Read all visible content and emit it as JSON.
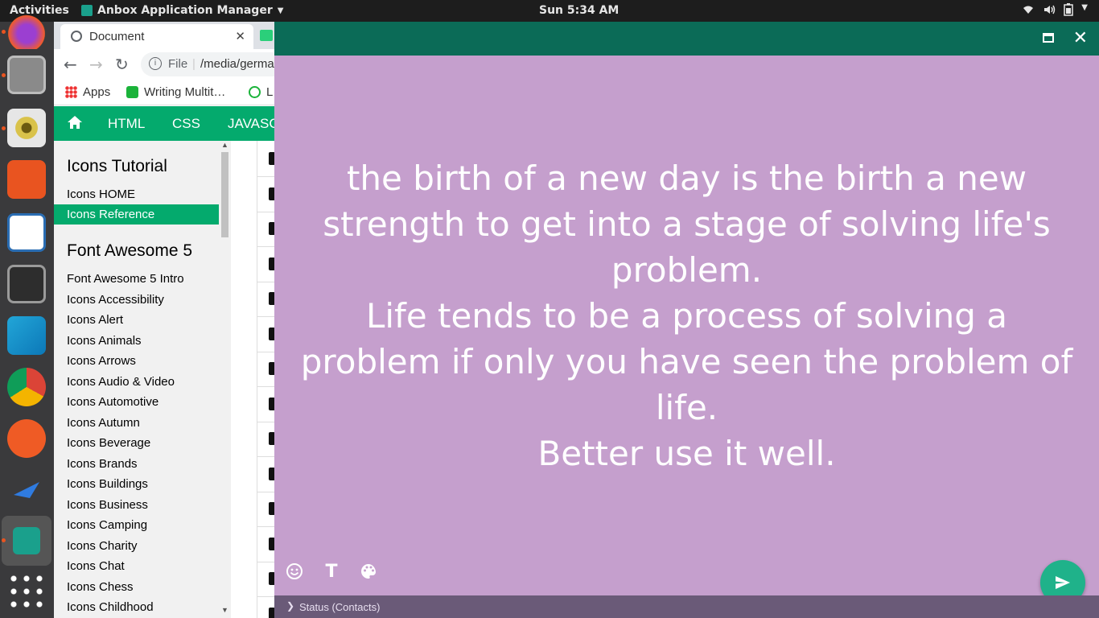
{
  "topbar": {
    "activities": "Activities",
    "app_menu": "Anbox Application Manager",
    "clock": "Sun  5:34 AM"
  },
  "dock": {
    "items": [
      "firefox-icon",
      "files-icon",
      "rhythmbox-icon",
      "software-center-icon",
      "writer-icon",
      "terminal-icon",
      "vscode-icon",
      "chrome-icon",
      "postman-icon",
      "kingfisher-icon",
      "anbox-icon",
      "app-grid-icon"
    ]
  },
  "browser": {
    "tab_title": "Document",
    "omnibox": {
      "scheme": "File",
      "url": "/media/german"
    },
    "bookmarks": [
      "Apps",
      "Writing Multit…",
      "L"
    ],
    "site_nav": [
      "HTML",
      "CSS",
      "JAVASC"
    ],
    "sidebar": {
      "heading1": "Icons Tutorial",
      "links1": [
        "Icons HOME",
        "Icons Reference"
      ],
      "heading2": "Font Awesome 5",
      "links2": [
        "Font Awesome 5 Intro",
        "Icons Accessibility",
        "Icons Alert",
        "Icons Animals",
        "Icons Arrows",
        "Icons Audio & Video",
        "Icons Automotive",
        "Icons Autumn",
        "Icons Beverage",
        "Icons Brands",
        "Icons Buildings",
        "Icons Business",
        "Icons Camping",
        "Icons Charity",
        "Icons Chat",
        "Icons Chess",
        "Icons Childhood"
      ]
    }
  },
  "anbox": {
    "status_lines": [
      "the birth of a new day is the birth a new",
      "strength to get into a stage of solving life's",
      "problem.",
      "Life tends to be a process of solving a",
      "problem if only you have seen the problem of",
      "life.",
      "Better use it well."
    ],
    "text_tool": "T",
    "status_bar_label": "Status (Contacts)",
    "colors": {
      "background": "#c59fcd",
      "title_bar": "#0b6b57",
      "send_button": "#1fb28a"
    }
  }
}
